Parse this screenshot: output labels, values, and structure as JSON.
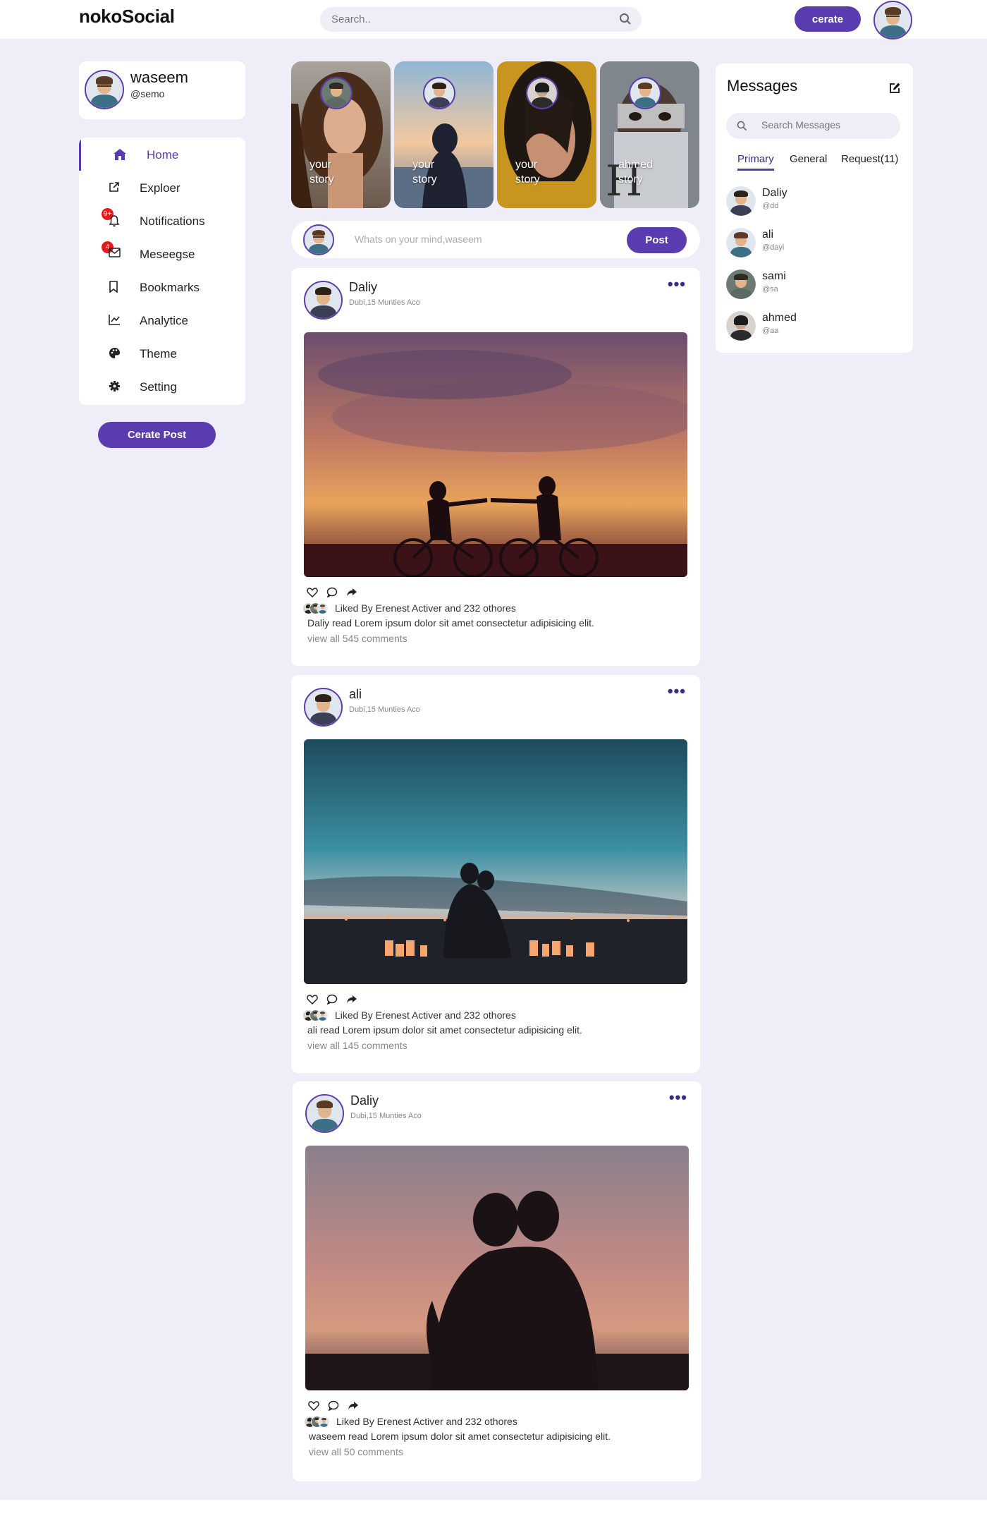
{
  "app": {
    "logo": "nokoSocial"
  },
  "header": {
    "search_placeholder": "Search..",
    "create_label": "cerate"
  },
  "profile": {
    "name": "waseem",
    "handle": "@semo"
  },
  "sidebar": {
    "items": [
      {
        "label": "Home",
        "icon": "home-icon",
        "active": true
      },
      {
        "label": "Exploer",
        "icon": "external-link-icon"
      },
      {
        "label": "Notifications",
        "icon": "bell-icon",
        "badge": "9+"
      },
      {
        "label": "Meseegse",
        "icon": "envelope-icon",
        "badge": "4"
      },
      {
        "label": "Bookmarks",
        "icon": "bookmark-icon"
      },
      {
        "label": "Analytice",
        "icon": "chart-line-icon"
      },
      {
        "label": "Theme",
        "icon": "palette-icon"
      },
      {
        "label": "Setting",
        "icon": "gear-icon"
      }
    ],
    "create_post_label": "Cerate Post"
  },
  "stories": [
    {
      "line1": "your",
      "line2": "story"
    },
    {
      "line1": "your",
      "line2": "story"
    },
    {
      "line1": "your",
      "line2": "story"
    },
    {
      "line1": "ahmed",
      "line2": "story"
    }
  ],
  "composer": {
    "placeholder": "Whats on your mind,waseem",
    "post_label": "Post"
  },
  "posts": [
    {
      "author": "Daliy",
      "meta": "Dubi,15 Munties Aco",
      "more": "•••",
      "liked_text": "Liked By Erenest Activer and 232 othores",
      "caption": "Daliy read Lorem ipsum dolor sit amet consectetur adipisicing elit.",
      "comments": "view all 545 comments"
    },
    {
      "author": "ali",
      "meta": "Dubi,15 Munties Aco",
      "more": "•••",
      "liked_text": "Liked By Erenest Activer and 232 othores",
      "caption": "ali read Lorem ipsum dolor sit amet consectetur adipisicing elit.",
      "comments": "view all 145 comments"
    },
    {
      "author": "Daliy",
      "meta": "Dubi,15 Munties Aco",
      "more": "•••",
      "liked_text": "Liked By Erenest Activer and 232 othores",
      "caption": "waseem read Lorem ipsum dolor sit amet consectetur adipisicing elit.",
      "comments": "view all 50 comments"
    }
  ],
  "messages": {
    "title": "Messages",
    "search_placeholder": "Search Messages",
    "tabs": [
      {
        "label": "Primary",
        "active": true
      },
      {
        "label": "General"
      },
      {
        "label": "Request(11)"
      }
    ],
    "contacts": [
      {
        "name": "Daliy",
        "handle": "@dd"
      },
      {
        "name": "ali",
        "handle": "@dayi"
      },
      {
        "name": "sami",
        "handle": "@sa"
      },
      {
        "name": "ahmed",
        "handle": "@aa"
      }
    ]
  },
  "colors": {
    "accent": "#5b3cb0",
    "background": "#efedf7",
    "badge": "#e81919"
  }
}
